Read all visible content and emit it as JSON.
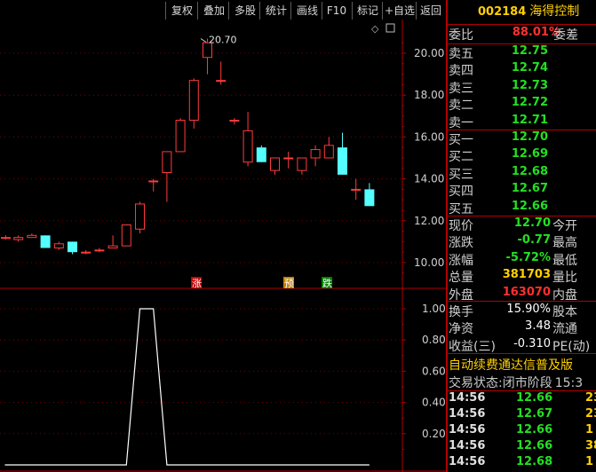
{
  "toolbar": {
    "buttons": [
      "复权",
      "叠加",
      "多股",
      "统计",
      "画线",
      "F10",
      "标记",
      "+自选",
      "返回"
    ]
  },
  "stock": {
    "code": "002184",
    "name": "海得控制"
  },
  "weibi": {
    "label": "委比",
    "value": "88.01%",
    "label2": "委差"
  },
  "asks": [
    {
      "label": "卖五",
      "price": "12.75"
    },
    {
      "label": "卖四",
      "price": "12.74"
    },
    {
      "label": "卖三",
      "price": "12.73"
    },
    {
      "label": "卖二",
      "price": "12.72"
    },
    {
      "label": "卖一",
      "price": "12.71"
    }
  ],
  "bids": [
    {
      "label": "买一",
      "price": "12.70"
    },
    {
      "label": "买二",
      "price": "12.69"
    },
    {
      "label": "买三",
      "price": "12.68"
    },
    {
      "label": "买四",
      "price": "12.67"
    },
    {
      "label": "买五",
      "price": "12.66"
    }
  ],
  "quote": [
    {
      "label": "现价",
      "value": "12.70",
      "label2": "今开",
      "color": "green"
    },
    {
      "label": "涨跌",
      "value": "-0.77",
      "label2": "最高",
      "color": "green"
    },
    {
      "label": "涨幅",
      "value": "-5.72%",
      "label2": "最低",
      "color": "green"
    },
    {
      "label": "总量",
      "value": "381703",
      "label2": "量比",
      "color": "yellow"
    },
    {
      "label": "外盘",
      "value": "163070",
      "label2": "内盘",
      "color": "red"
    }
  ],
  "stats": [
    {
      "label": "换手",
      "value": "15.90%",
      "label2": "股本"
    },
    {
      "label": "净资",
      "value": "3.48",
      "label2": "流通"
    },
    {
      "label": "收益(三)",
      "value": "-0.310",
      "label2": "PE(动)"
    }
  ],
  "promo": "自动续费通达信普及版",
  "status": {
    "label": "交易状态:",
    "value": "闭市阶段",
    "time": "15:3"
  },
  "ticks": [
    {
      "time": "14:56",
      "price": "12.66",
      "vol": "23"
    },
    {
      "time": "14:56",
      "price": "12.67",
      "vol": "23"
    },
    {
      "time": "14:56",
      "price": "12.66",
      "vol": "1"
    },
    {
      "time": "14:56",
      "price": "12.66",
      "vol": "38"
    },
    {
      "time": "14:56",
      "price": "12.68",
      "vol": "1"
    }
  ],
  "main_chart": {
    "y_ticks": [
      "20.00",
      "18.00",
      "16.00",
      "14.00",
      "12.00",
      "10.00"
    ],
    "peak_label": "20.70",
    "markers": [
      "涨",
      "预",
      "跌"
    ]
  },
  "sub_chart": {
    "y_ticks": [
      "1.00",
      "0.80",
      "0.60",
      "0.40",
      "0.20"
    ]
  },
  "chart_data": {
    "type": "candlestick",
    "y_range": [
      9.4,
      21.2
    ],
    "candles": [
      {
        "o": 11.2,
        "c": 11.2,
        "h": 11.3,
        "l": 11.1
      },
      {
        "o": 11.1,
        "c": 11.2,
        "h": 11.3,
        "l": 11.0
      },
      {
        "o": 11.2,
        "c": 11.3,
        "h": 11.4,
        "l": 11.2
      },
      {
        "o": 11.3,
        "c": 10.7,
        "h": 11.3,
        "l": 10.7
      },
      {
        "o": 10.7,
        "c": 10.9,
        "h": 11.0,
        "l": 10.6
      },
      {
        "o": 11.0,
        "c": 10.5,
        "h": 11.0,
        "l": 10.4
      },
      {
        "o": 10.5,
        "c": 10.5,
        "h": 10.6,
        "l": 10.4
      },
      {
        "o": 10.6,
        "c": 10.6,
        "h": 10.7,
        "l": 10.5
      },
      {
        "o": 10.7,
        "c": 10.8,
        "h": 11.3,
        "l": 10.7
      },
      {
        "o": 10.8,
        "c": 11.8,
        "h": 11.8,
        "l": 10.8
      },
      {
        "o": 11.6,
        "c": 12.8,
        "h": 12.9,
        "l": 11.4
      },
      {
        "o": 13.9,
        "c": 13.9,
        "h": 14.0,
        "l": 13.4
      },
      {
        "o": 14.3,
        "c": 15.3,
        "h": 15.3,
        "l": 12.9
      },
      {
        "o": 15.3,
        "c": 16.8,
        "h": 16.9,
        "l": 15.3
      },
      {
        "o": 16.8,
        "c": 18.7,
        "h": 18.8,
        "l": 16.4
      },
      {
        "o": 19.8,
        "c": 20.5,
        "h": 20.7,
        "l": 19.0
      },
      {
        "o": 18.7,
        "c": 18.7,
        "h": 19.6,
        "l": 18.5
      },
      {
        "o": 16.8,
        "c": 16.8,
        "h": 16.9,
        "l": 16.6
      },
      {
        "o": 14.8,
        "c": 16.3,
        "h": 17.2,
        "l": 14.6
      },
      {
        "o": 15.5,
        "c": 14.8,
        "h": 15.6,
        "l": 14.8
      },
      {
        "o": 14.4,
        "c": 15.0,
        "h": 15.0,
        "l": 14.2
      },
      {
        "o": 15.0,
        "c": 15.0,
        "h": 15.3,
        "l": 14.5
      },
      {
        "o": 14.4,
        "c": 15.0,
        "h": 15.0,
        "l": 14.2
      },
      {
        "o": 15.0,
        "c": 15.4,
        "h": 15.6,
        "l": 14.6
      },
      {
        "o": 15.0,
        "c": 15.6,
        "h": 16.0,
        "l": 15.0
      },
      {
        "o": 15.5,
        "c": 14.2,
        "h": 16.2,
        "l": 14.2
      },
      {
        "o": 13.5,
        "c": 13.5,
        "h": 14.0,
        "l": 13.0
      },
      {
        "o": 13.5,
        "c": 12.7,
        "h": 13.8,
        "l": 12.7
      }
    ],
    "indicator": [
      0,
      0,
      0,
      0,
      0,
      0,
      0,
      0,
      0,
      0,
      1,
      1,
      0,
      0,
      0,
      0,
      0,
      0,
      0,
      0,
      0,
      0,
      0,
      0,
      0,
      0,
      0,
      0
    ]
  }
}
